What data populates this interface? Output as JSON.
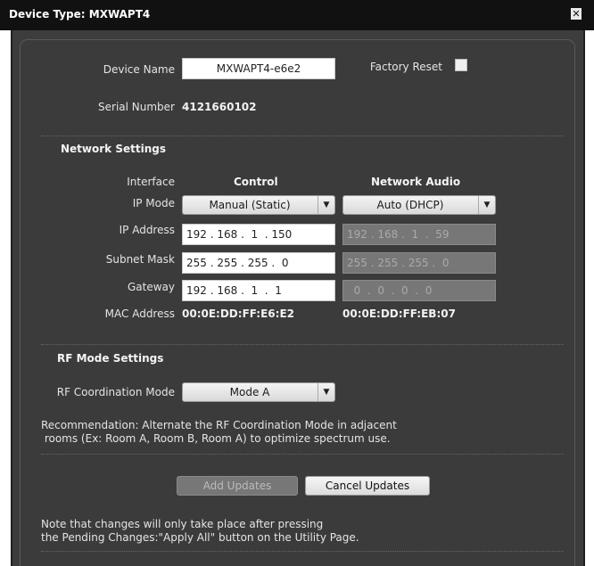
{
  "window": {
    "title": "Device Type: MXWAPT4",
    "close_glyph": "✕"
  },
  "device": {
    "name_label": "Device Name",
    "name_value": "MXWAPT4-e6e2",
    "factory_reset_label": "Factory Reset",
    "serial_label": "Serial Number",
    "serial_value": "4121660102"
  },
  "network": {
    "heading": "Network Settings",
    "interface_label": "Interface",
    "control_heading": "Control",
    "audio_heading": "Network Audio",
    "ip_mode_label": "IP Mode",
    "control_ip_mode": "Manual (Static)",
    "audio_ip_mode": "Auto (DHCP)",
    "ip_label": "IP Address",
    "control_ip": "192 . 168 .  1  . 150",
    "audio_ip": "192 . 168 .  1  .  59",
    "mask_label": "Subnet Mask",
    "control_mask": "255 . 255 . 255 .  0",
    "audio_mask": "255 . 255 . 255 .  0",
    "gateway_label": "Gateway",
    "control_gateway": "192 . 168 .  1  .  1",
    "audio_gateway": "  0  .  0  .  0  .  0",
    "mac_label": "MAC Address",
    "control_mac": "00:0E:DD:FF:E6:E2",
    "audio_mac": "00:0E:DD:FF:EB:07"
  },
  "rf": {
    "heading": "RF Mode Settings",
    "coord_label": "RF Coordination Mode",
    "coord_value": "Mode A",
    "recommendation_line1": "Recommendation: Alternate the RF Coordination Mode in adjacent",
    "recommendation_line2": " rooms (Ex: Room A, Room B, Room A) to optimize spectrum use."
  },
  "actions": {
    "add_label": "Add Updates",
    "cancel_label": "Cancel Updates"
  },
  "note": {
    "line1": "Note that changes will only take place after pressing",
    "line2": "the Pending Changes:\"Apply All\" button on the Utility Page."
  }
}
